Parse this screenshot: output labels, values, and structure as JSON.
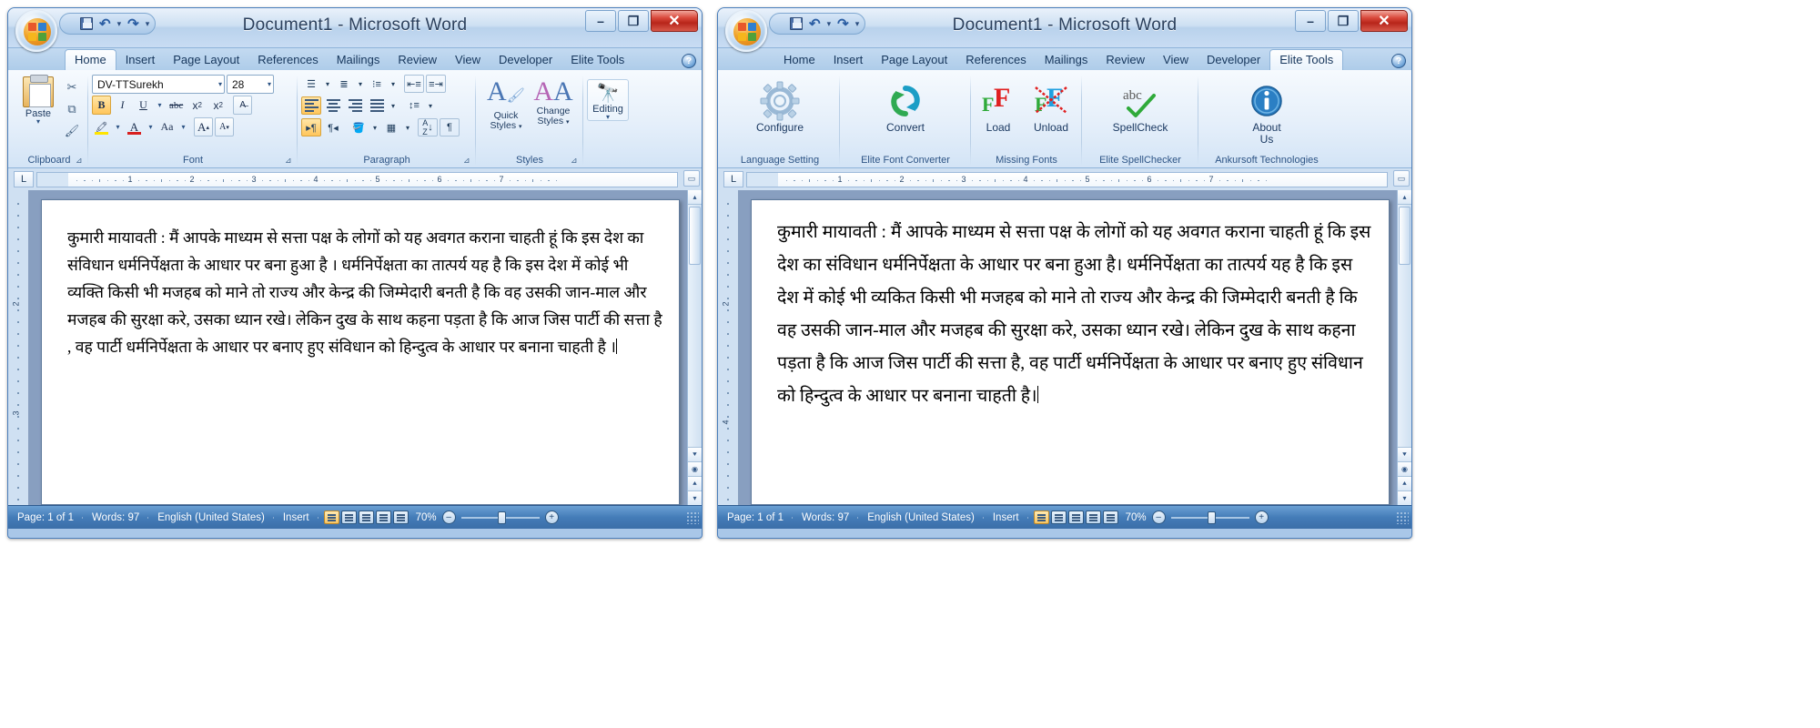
{
  "windows": [
    {
      "id": "left",
      "title": "Document1 - Microsoft Word",
      "quick_access": {
        "save": "save-icon",
        "undo": "undo-icon",
        "redo": "redo-icon",
        "customize": "customize-icon"
      },
      "window_buttons": {
        "minimize": "–",
        "maximize": "❐",
        "close": "✕"
      },
      "tabs": [
        "Home",
        "Insert",
        "Page Layout",
        "References",
        "Mailings",
        "Review",
        "View",
        "Developer",
        "Elite Tools"
      ],
      "active_tab": "Home",
      "help": "?",
      "ribbon": {
        "groups": [
          {
            "label": "Clipboard",
            "dialog_launcher": true,
            "paste": "Paste",
            "small_buttons": [
              "cut-icon",
              "copy-icon",
              "format-painter-icon"
            ]
          },
          {
            "label": "Font",
            "dialog_launcher": true,
            "font_name": "DV-TTSurekh",
            "font_size": "28",
            "buttons": [
              "Bold",
              "Italic",
              "Underline",
              "Strikethrough",
              "Subscript",
              "Superscript",
              "Clear Formatting",
              "Text Highlight Color",
              "Font Color",
              "Change Case",
              "Grow Font",
              "Shrink Font"
            ]
          },
          {
            "label": "Paragraph",
            "dialog_launcher": true,
            "buttons": [
              "Bullets",
              "Numbering",
              "Multilevel List",
              "Decrease Indent",
              "Increase Indent",
              "Align Left",
              "Center",
              "Align Right",
              "Justify",
              "Line Spacing",
              "LTR Text Direction",
              "RTL Text Direction",
              "Shading",
              "Borders",
              "Sort",
              "Show/Hide ¶"
            ]
          },
          {
            "label": "Styles",
            "dialog_launcher": true,
            "quick_styles": "Quick\nStyles",
            "change_styles": "Change\nStyles"
          },
          {
            "label": "",
            "editing": "Editing"
          }
        ]
      },
      "ruler": {
        "numbers": [
          "1",
          "2",
          "3",
          "4",
          "5",
          "6",
          "7"
        ],
        "tab_selector": "L"
      },
      "document": {
        "paragraph": "कुमारी मायावती :   मैं आपके माध्यम से सत्ता पक्ष के लोगों को यह अवगत कराना चाहती हूं कि  इस देश का संविधान धर्मनिर्पेक्षता के  आधार पर  बना हुआ है । धर्मनिर्पेक्षता का तात्पर्य यह है कि  इस देश में कोई भी व्यक्ति किसी भी मजहब को माने तो राज्य और  केन्द्र की जिम्मेदारी बनती है कि  वह उसकी जान-माल और मजहब की सुरक्षा करे, उसका ध्यान रखे। लेकिन दुख के साथ कहना पड़ता है कि  आज जिस पार्टी की सत्ता है , वह पार्टी धर्मनिर्पेक्षता के  आधार पर  बनाए हुए संविधान को हिन्दुत्व के आधार पर बनाना चाहती है ।",
        "has_caret": true
      },
      "status": {
        "page": "Page: 1 of 1",
        "words": "Words: 97",
        "language": "English (United States)",
        "mode": "Insert",
        "zoom": "70%",
        "view_buttons": [
          "Print Layout",
          "Full Screen Reading",
          "Web Layout",
          "Outline",
          "Draft"
        ],
        "zoom_out": "–",
        "zoom_in": "+"
      }
    },
    {
      "id": "right",
      "title": "Document1 - Microsoft Word",
      "quick_access": {
        "save": "save-icon",
        "undo": "undo-icon",
        "redo": "redo-icon",
        "customize": "customize-icon"
      },
      "window_buttons": {
        "minimize": "–",
        "maximize": "❐",
        "close": "✕"
      },
      "tabs": [
        "Home",
        "Insert",
        "Page Layout",
        "References",
        "Mailings",
        "Review",
        "View",
        "Developer",
        "Elite Tools"
      ],
      "active_tab": "Elite Tools",
      "help": "?",
      "ribbon": {
        "groups": [
          {
            "label": "Language Setting",
            "items": [
              {
                "label": "Configure",
                "icon": "gear-icon"
              }
            ]
          },
          {
            "label": "Elite Font Converter",
            "items": [
              {
                "label": "Convert",
                "icon": "refresh-arrows-icon"
              }
            ]
          },
          {
            "label": "Missing Fonts",
            "items": [
              {
                "label": "Load",
                "icon": "load-font-icon"
              },
              {
                "label": "Unload",
                "icon": "unload-font-icon"
              }
            ]
          },
          {
            "label": "Elite SpellChecker",
            "items": [
              {
                "label": "SpellCheck",
                "icon": "abc-check-icon"
              }
            ]
          },
          {
            "label": "Ankursoft Technologies",
            "items": [
              {
                "label": "About\nUs",
                "icon": "info-icon"
              }
            ]
          }
        ]
      },
      "ruler": {
        "numbers": [
          "1",
          "2",
          "3",
          "4",
          "5",
          "6",
          "7"
        ],
        "tab_selector": "L"
      },
      "document": {
        "paragraph": "कुमारी मायावती : मैं आपके माध्यम से सत्ता पक्ष के लोगों को यह अवगत कराना चाहती हूं कि इस देश का संविधान धर्मनिर्पेक्षता के आधार पर बना हुआ है। धर्मनिर्पेक्षता का तात्पर्य यह है कि इस देश में कोई भी व्यकित किसी भी मजहब को माने तो राज्य और केन्द्र की जिम्मेदारी बनती है कि वह उसकी जान-माल और मजहब की सुरक्षा करे, उसका ध्यान रखे। लेकिन दुख के साथ कहना पड़ता है कि आज जिस पार्टी की सत्ता है, वह पार्टी धर्मनिर्पेक्षता के आधार पर बनाए हुए संविधान को हिन्दुत्व के आधार पर बनाना चाहती है।",
        "has_caret": true
      },
      "status": {
        "page": "Page: 1 of 1",
        "words": "Words: 97",
        "language": "English (United States)",
        "mode": "Insert",
        "zoom": "70%",
        "view_buttons": [
          "Print Layout",
          "Full Screen Reading",
          "Web Layout",
          "Outline",
          "Draft"
        ],
        "zoom_out": "–",
        "zoom_in": "+"
      }
    }
  ],
  "colors": {
    "titlebar_blue": "#b9d2ec",
    "ribbon_bg": "#e5effa",
    "status_blue": "#447cb8",
    "close_red": "#b8251a",
    "accent_orange": "#ffc65c",
    "load_green": "#3aa43a",
    "load_red": "#e02020",
    "load_blue": "#1fa0e0"
  }
}
